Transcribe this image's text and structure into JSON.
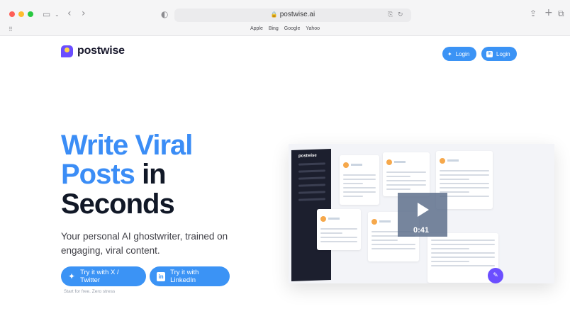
{
  "browser": {
    "url": "postwise.ai",
    "bookmarks": [
      "Apple",
      "Bing",
      "Google",
      "Yahoo"
    ],
    "icons": {
      "sidebar": "sidebar-toggle-icon",
      "back": "chevron-left-icon",
      "forward": "chevron-right-icon",
      "shield": "privacy-shield-icon",
      "translate": "translate-icon",
      "reload": "reload-icon",
      "share": "share-icon",
      "new_tab": "plus-icon",
      "tabs": "tab-overview-icon",
      "grid": "grid-icon"
    }
  },
  "site": {
    "brand": "postwise",
    "login_twitter": "Login",
    "login_linkedin": "Login",
    "accent_color": "#3b93f5",
    "brand_color": "#6b4eff"
  },
  "hero": {
    "line1": "Write Viral",
    "line2_blue": "Posts",
    "line2_dark": "in",
    "line3": "Seconds",
    "subtitle": "Your personal AI ghostwriter, trained on engaging, viral content.",
    "cta_twitter": "Try it with X / Twitter",
    "cta_linkedin": "Try it with LinkedIn",
    "note": "Start for free. Zero stress"
  },
  "video": {
    "duration": "0:41",
    "app_title": "postwise"
  }
}
